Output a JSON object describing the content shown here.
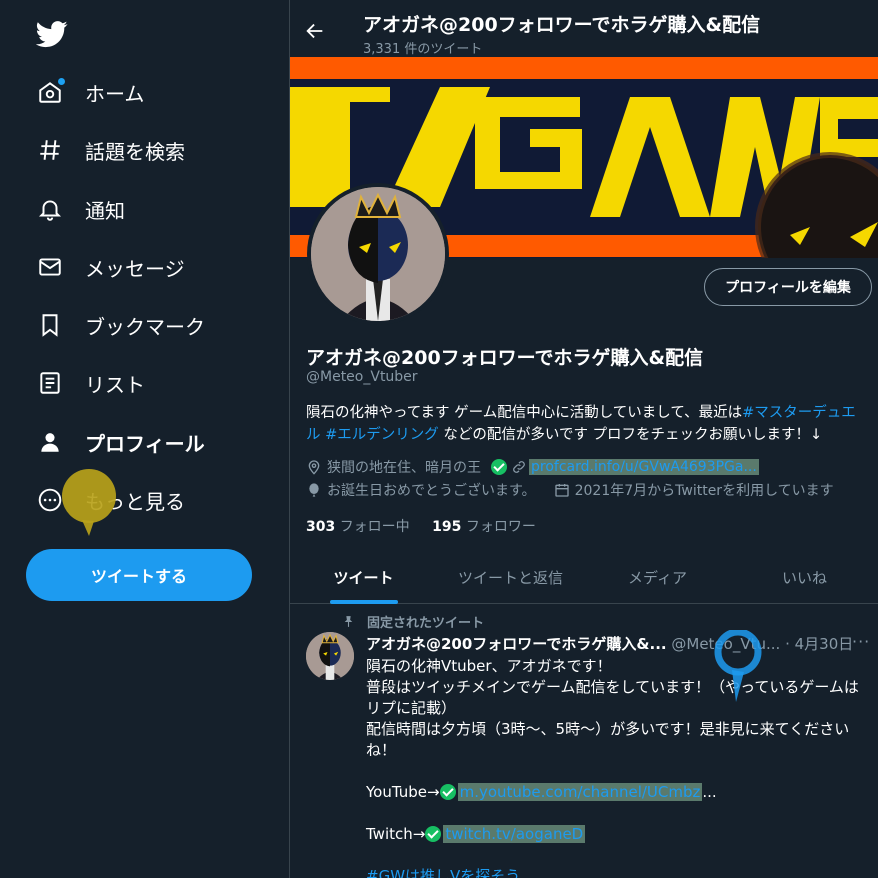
{
  "sidebar": {
    "logo_icon": "twitter-bird-icon",
    "items": [
      {
        "label": "ホーム",
        "icon": "home-icon"
      },
      {
        "label": "話題を検索",
        "icon": "hashtag-icon"
      },
      {
        "label": "通知",
        "icon": "bell-icon"
      },
      {
        "label": "メッセージ",
        "icon": "envelope-icon"
      },
      {
        "label": "ブックマーク",
        "icon": "bookmark-icon"
      },
      {
        "label": "リスト",
        "icon": "list-icon"
      },
      {
        "label": "プロフィール",
        "icon": "person-icon"
      },
      {
        "label": "もっと見る",
        "icon": "more-circle-icon"
      }
    ],
    "tweet_button": "ツイートする"
  },
  "header": {
    "name": "アオガネ@200フォロワーでホラゲ購入&配信",
    "tweet_count": "3,331 件のツイート"
  },
  "profile": {
    "edit_button": "プロフィールを編集",
    "name": "アオガネ@200フォロワーでホラゲ購入&配信",
    "handle": "@Meteo_Vtuber",
    "bio_1": "隕石の化神やってます ゲーム配信中心に活動していまして、最近は",
    "bio_tag1": "#マスターデュエル",
    "bio_tag2": "#エルデンリング",
    "bio_2": "などの配信が多いです プロフをチェックお願いします！↓",
    "location": "狭間の地在住、暗月の王",
    "link": "profcard.info/u/GVwA4693PGa...",
    "birthday": "お誕生日おめでとうございます。",
    "joined": "2021年7月からTwitterを利用しています",
    "following_count": "303",
    "following_label": "フォロー中",
    "followers_count": "195",
    "followers_label": "フォロワー"
  },
  "tabs": [
    "ツイート",
    "ツイートと返信",
    "メディア",
    "いいね"
  ],
  "pinned_tweet": {
    "label": "固定されたツイート",
    "name": "アオガネ@200フォロワーでホラゲ購入&...",
    "handle": "@Meteo_Vtu...",
    "date": "4月30日",
    "more": "···",
    "line1": "隕石の化神Vtuber、アオガネです！",
    "line2": "普段はツイッチメインでゲーム配信をしています！（やっているゲームは",
    "line3": "リプに記載）",
    "line4": "配信時間は夕方頃（3時〜、5時〜）が多いです！是非見に来てください",
    "line5": "ね！",
    "youtube_label": "YouTube→",
    "youtube_link": "m.youtube.com/channel/UCmbz",
    "youtube_ellipsis": "...",
    "twitch_label": "Twitch→",
    "twitch_link": "twitch.tv/aoganeD",
    "hashtag": "#GWは推しVを探そう"
  },
  "colors": {
    "background": "#15202b",
    "accent": "#1d9bf0",
    "muted": "#8899a6",
    "border": "#38444d",
    "verified_green": "#17bf63"
  }
}
